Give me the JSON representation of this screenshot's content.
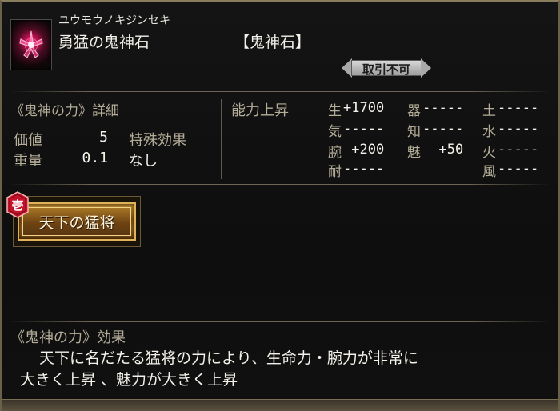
{
  "item": {
    "reading": "ユウモウノキジンセキ",
    "name": "勇猛の鬼神石",
    "category": "【鬼神石】",
    "trade_status": "取引不可",
    "icon": "flower-gem-icon"
  },
  "details": {
    "title": "《鬼神の力》詳細",
    "value_label": "価値",
    "value": "5",
    "weight_label": "重量",
    "weight": "0.1",
    "special_label": "特殊効果",
    "special_value": "なし"
  },
  "abilities": {
    "title": "能力上昇",
    "items": [
      {
        "label": "生",
        "value": "+1700"
      },
      {
        "label": "器",
        "value": "-----"
      },
      {
        "label": "土",
        "value": "-----"
      },
      {
        "label": "気",
        "value": "-----"
      },
      {
        "label": "知",
        "value": "-----"
      },
      {
        "label": "水",
        "value": "-----"
      },
      {
        "label": "腕",
        "value": " +200"
      },
      {
        "label": "魅",
        "value": "  +50"
      },
      {
        "label": "火",
        "value": "-----"
      },
      {
        "label": "耐",
        "value": "-----"
      },
      {
        "label": "風",
        "value": "-----"
      }
    ]
  },
  "title_plaque": {
    "rank": "壱",
    "label": "天下の猛将"
  },
  "effect": {
    "title": "《鬼神の力》効果",
    "line1": "天下に名だたる猛将の力により、生命力・腕力が非常に",
    "line2": "大きく上昇 、魅力が大きく上昇"
  },
  "colors": {
    "label": "#b4ad98",
    "value": "#f3f1ea",
    "plaque_gold": "#e0b25a",
    "rank_red": "#c4122a"
  }
}
